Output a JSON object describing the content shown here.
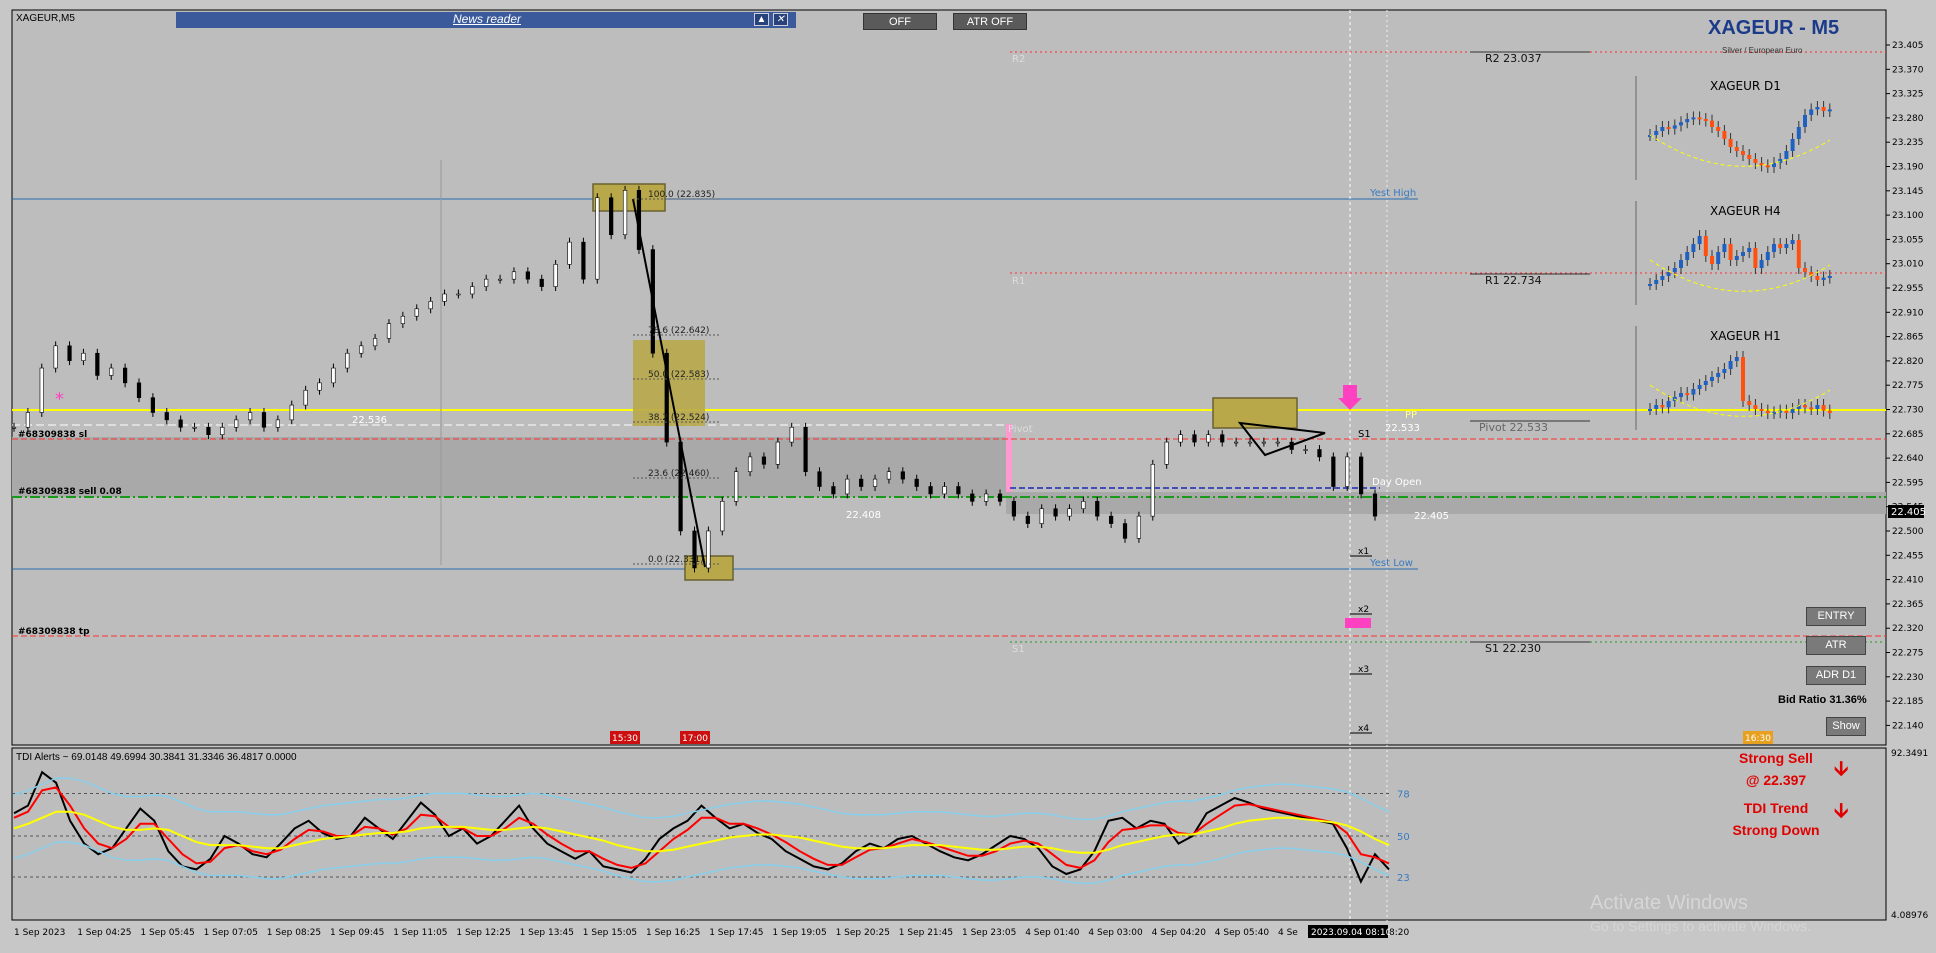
{
  "window": {
    "symbol_label": "XAGEUR,M5"
  },
  "news": {
    "title": "News reader",
    "up_glyph": "▲",
    "close_glyph": "✕"
  },
  "toolbar": {
    "off_label": "OFF",
    "atr_off_label": "ATR OFF"
  },
  "header": {
    "title": "XAGEUR - M5",
    "subtitle": "Silver / European Euro"
  },
  "mini_charts": [
    {
      "label": "XAGEUR D1"
    },
    {
      "label": "XAGEUR H4"
    },
    {
      "label": "XAGEUR H1"
    }
  ],
  "right_panel": {
    "entry": "ENTRY",
    "atr": "ATR",
    "adr": "ADR D1",
    "bid_ratio": "Bid Ratio 31.36%",
    "show": "Show"
  },
  "signal": {
    "line1": "Strong Sell",
    "line2": "@ 22.397",
    "line3": "TDI Trend",
    "line4": "Strong Down",
    "arrow_glyph": "🡫"
  },
  "watermark": {
    "line1": "Activate Windows",
    "line2": "Go to Settings to activate Windows."
  },
  "tdi": {
    "title": "TDI Alerts ~ 69.0148 49.6994 30.3841 31.3346 36.4817 0.0000",
    "levels": [
      "78",
      "50",
      "23"
    ],
    "axis_top": "92.3491",
    "axis_bottom": "4.08976"
  },
  "colors": {
    "background": "#c7c7c7",
    "support_line": "#ffff00",
    "pivot_red": "#ff3030",
    "trade_green": "#1a9a1a",
    "up_candle": "#2060c0",
    "down_candle": "#ff5010",
    "tdi_price": "#000000",
    "tdi_signal": "#ff0000",
    "tdi_market_base": "#ffff00",
    "tdi_bands": "#87ceeb"
  },
  "chart_data": [
    {
      "type": "line",
      "series_style": "candlestick",
      "ylim": [
        22.095,
        23.043
      ],
      "y_ticks": [
        23.405,
        23.37,
        23.325,
        23.28,
        23.235,
        23.19,
        23.145,
        23.1,
        23.055,
        23.01,
        22.955,
        22.91,
        22.865,
        22.82,
        22.775,
        22.73,
        22.685,
        22.64,
        22.595,
        22.545,
        22.5,
        22.455,
        22.41,
        22.365,
        22.32,
        22.275,
        22.23,
        22.185,
        22.14,
        22.095
      ],
      "y_tick_labels": [
        "23.405",
        "23.370",
        "23.325",
        "23.280",
        "23.235",
        "23.190",
        "23.145",
        "23.100",
        "23.055",
        "23.010",
        "22.955",
        "22.910",
        "22.865",
        "22.820",
        "22.775",
        "22.730",
        "22.685",
        "22.640",
        "22.595",
        "22.545",
        "22.500",
        "22.455",
        "22.410",
        "22.365",
        "22.320",
        "22.275",
        "22.230",
        "22.185",
        "22.140",
        "22.095"
      ],
      "current_price": "22.405",
      "x_tick_labels": [
        "1 Sep 2023",
        "1 Sep 04:25",
        "1 Sep 05:45",
        "1 Sep 07:05",
        "1 Sep 08:25",
        "1 Sep 09:45",
        "1 Sep 11:05",
        "1 Sep 12:25",
        "1 Sep 13:45",
        "1 Sep 15:05",
        "1 Sep 16:25",
        "1 Sep 17:45",
        "1 Sep 19:05",
        "1 Sep 20:25",
        "1 Sep 21:45",
        "1 Sep 23:05",
        "4 Sep 01:40",
        "4 Sep 03:00",
        "4 Sep 04:20",
        "4 Sep 05:40",
        "4 Se",
        "2023.09.04 08:10",
        "8:20"
      ],
      "close": [
        22.52,
        22.54,
        22.6,
        22.63,
        22.61,
        22.62,
        22.59,
        22.6,
        22.58,
        22.56,
        22.54,
        22.53,
        22.52,
        22.52,
        22.51,
        22.52,
        22.53,
        22.54,
        22.52,
        22.53,
        22.55,
        22.57,
        22.58,
        22.6,
        22.62,
        22.63,
        22.64,
        22.66,
        22.67,
        22.68,
        22.69,
        22.7,
        22.7,
        22.71,
        22.72,
        22.72,
        22.73,
        22.72,
        22.71,
        22.74,
        22.77,
        22.72,
        22.83,
        22.78,
        22.84,
        22.76,
        22.62,
        22.5,
        22.38,
        22.33,
        22.38,
        22.42,
        22.46,
        22.48,
        22.47,
        22.5,
        22.52,
        22.46,
        22.44,
        22.43,
        22.45,
        22.44,
        22.45,
        22.46,
        22.45,
        22.44,
        22.43,
        22.44,
        22.43,
        22.42,
        22.43,
        22.42,
        22.4,
        22.39,
        22.41,
        22.4,
        22.41,
        22.42,
        22.4,
        22.39,
        22.37,
        22.4,
        22.47,
        22.5,
        22.51,
        22.5,
        22.51,
        22.5,
        22.5,
        22.5,
        22.5,
        22.5,
        22.49,
        22.49,
        22.48,
        22.44,
        22.48,
        22.43,
        22.4
      ],
      "annotations": {
        "fib_levels": [
          "100.0 (22.835)",
          "78.6 (22.642)",
          "50.0 (22.583)",
          "38.2 (22.524)",
          "23.6 (22.460)",
          "0.0 (22.331)"
        ],
        "pivots": [
          "R2 23.037",
          "R1 22.734",
          "Pivot 22.533",
          "S1 22.230"
        ],
        "level_labels": [
          "R2",
          "R1",
          "Pivot",
          "S1",
          "PP",
          "Yest High",
          "Yest Low",
          "Day Open",
          "S1"
        ],
        "price_labels": [
          "22.536",
          "22.408",
          "22.533",
          "22.405"
        ],
        "trade_labels": [
          "#68309838 sl",
          "#68309838 sell 0.08",
          "#68309838 tp"
        ],
        "x_markers": [
          "x1",
          "x2",
          "x3",
          "x4"
        ],
        "session_tags": [
          "15:30",
          "17:00",
          "16:30"
        ]
      }
    },
    {
      "type": "line",
      "title": "TDI Alerts",
      "ylim": [
        0,
        100
      ],
      "levels": [
        78,
        50,
        23
      ],
      "series": [
        {
          "values": [
            65,
            70,
            92,
            85,
            60,
            45,
            38,
            42,
            55,
            68,
            60,
            40,
            30,
            28,
            35,
            50,
            45,
            38,
            36,
            45,
            55,
            60,
            52,
            48,
            50,
            62,
            55,
            48,
            60,
            72,
            64,
            50,
            55,
            45,
            50,
            60,
            70,
            55,
            45,
            40,
            35,
            40,
            30,
            28,
            26,
            35,
            48,
            55,
            60,
            70,
            62,
            55,
            58,
            52,
            48,
            40,
            35,
            30,
            28,
            32,
            40,
            45,
            42,
            48,
            50,
            45,
            40,
            36,
            34,
            38,
            44,
            50,
            48,
            42,
            30,
            25,
            28,
            40,
            60,
            62,
            55,
            60,
            58,
            45,
            50,
            65,
            70,
            75,
            72,
            68,
            66,
            64,
            62,
            60,
            58,
            42,
            20,
            38,
            28
          ]
        },
        {
          "values": [
            62,
            66,
            80,
            82,
            70,
            55,
            45,
            42,
            48,
            58,
            58,
            48,
            38,
            32,
            33,
            42,
            44,
            40,
            38,
            41,
            48,
            54,
            53,
            50,
            50,
            56,
            55,
            51,
            55,
            64,
            63,
            56,
            55,
            50,
            50,
            55,
            62,
            58,
            51,
            45,
            40,
            40,
            35,
            31,
            29,
            32,
            40,
            48,
            54,
            62,
            62,
            58,
            58,
            55,
            51,
            46,
            40,
            35,
            31,
            31,
            36,
            41,
            42,
            45,
            48,
            46,
            43,
            40,
            37,
            37,
            40,
            45,
            47,
            45,
            38,
            31,
            29,
            34,
            46,
            54,
            55,
            57,
            57,
            52,
            51,
            58,
            64,
            70,
            71,
            69,
            67,
            65,
            63,
            61,
            59,
            52,
            38,
            36,
            32
          ]
        },
        {
          "values": [
            55,
            58,
            62,
            66,
            66,
            64,
            60,
            56,
            54,
            54,
            55,
            54,
            50,
            46,
            44,
            44,
            44,
            43,
            42,
            42,
            44,
            46,
            48,
            49,
            50,
            51,
            52,
            52,
            53,
            55,
            56,
            56,
            56,
            55,
            54,
            54,
            55,
            56,
            55,
            53,
            51,
            49,
            47,
            44,
            42,
            40,
            40,
            41,
            43,
            45,
            47,
            49,
            50,
            51,
            51,
            50,
            49,
            47,
            45,
            43,
            42,
            42,
            42,
            43,
            44,
            44,
            44,
            43,
            42,
            41,
            41,
            42,
            43,
            43,
            42,
            40,
            39,
            39,
            41,
            44,
            46,
            48,
            50,
            51,
            51,
            53,
            55,
            58,
            60,
            61,
            62,
            62,
            61,
            60,
            59,
            57,
            53,
            48,
            44
          ]
        }
      ]
    }
  ]
}
